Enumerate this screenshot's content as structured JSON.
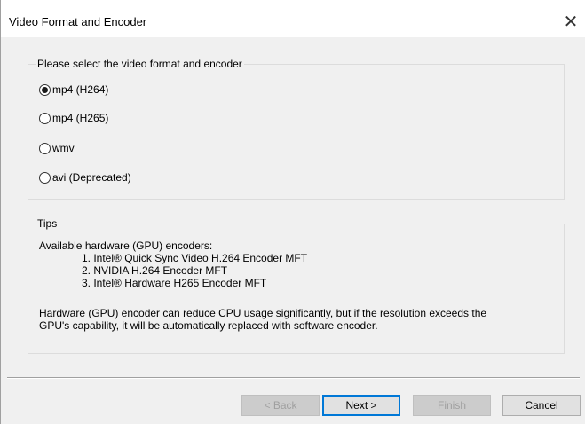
{
  "window": {
    "title": "Video Format and Encoder",
    "close_glyph": "✕"
  },
  "format_group": {
    "legend": "Please select the video format and encoder",
    "options": [
      {
        "label": "mp4 (H264)",
        "selected": true
      },
      {
        "label": "mp4 (H265)",
        "selected": false
      },
      {
        "label": "wmv",
        "selected": false
      },
      {
        "label": "avi (Deprecated)",
        "selected": false
      }
    ]
  },
  "tips_group": {
    "legend": "Tips",
    "encoders_heading": "Available hardware (GPU) encoders:",
    "encoders": [
      "1. Intel® Quick Sync Video H.264 Encoder MFT",
      "2. NVIDIA H.264 Encoder MFT",
      "3. Intel® Hardware H265 Encoder MFT"
    ],
    "note_line1": "Hardware (GPU) encoder can reduce CPU usage significantly, but if the resolution exceeds the",
    "note_line2": "GPU's capability, it will be automatically replaced with software encoder."
  },
  "buttons": {
    "back": "< Back",
    "next": "Next >",
    "finish": "Finish",
    "cancel": "Cancel"
  }
}
